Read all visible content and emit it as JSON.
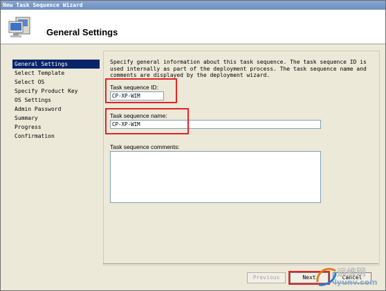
{
  "window": {
    "title": "New Task Sequence Wizard"
  },
  "header": {
    "title": "General Settings",
    "icon": "computer-icon"
  },
  "nav": {
    "items": [
      {
        "label": "General Settings",
        "active": true
      },
      {
        "label": "Select Template"
      },
      {
        "label": "Select OS"
      },
      {
        "label": "Specify Product Key"
      },
      {
        "label": "OS Settings"
      },
      {
        "label": "Admin Password"
      },
      {
        "label": "Summary"
      },
      {
        "label": "Progress"
      },
      {
        "label": "Confirmation"
      }
    ]
  },
  "main": {
    "intro": "Specify general information about this task sequence.  The task sequence ID is used internally as part of the deployment process.  The task sequence name and comments are displayed by the deployment wizard.",
    "id_label": "Task sequence ID:",
    "id_value": "CP-XP-WIM",
    "name_label": "Task sequence name:",
    "name_value": "CP-XP-WIM",
    "comments_label": "Task sequence comments:",
    "comments_value": ""
  },
  "buttons": {
    "previous": "Previous",
    "next": "Next",
    "cancel": "Cancel"
  },
  "watermark": {
    "text": "运维网",
    "url": "iyunv.com"
  },
  "colors": {
    "highlight": "#e32323",
    "nav_active": "#0a246a"
  }
}
